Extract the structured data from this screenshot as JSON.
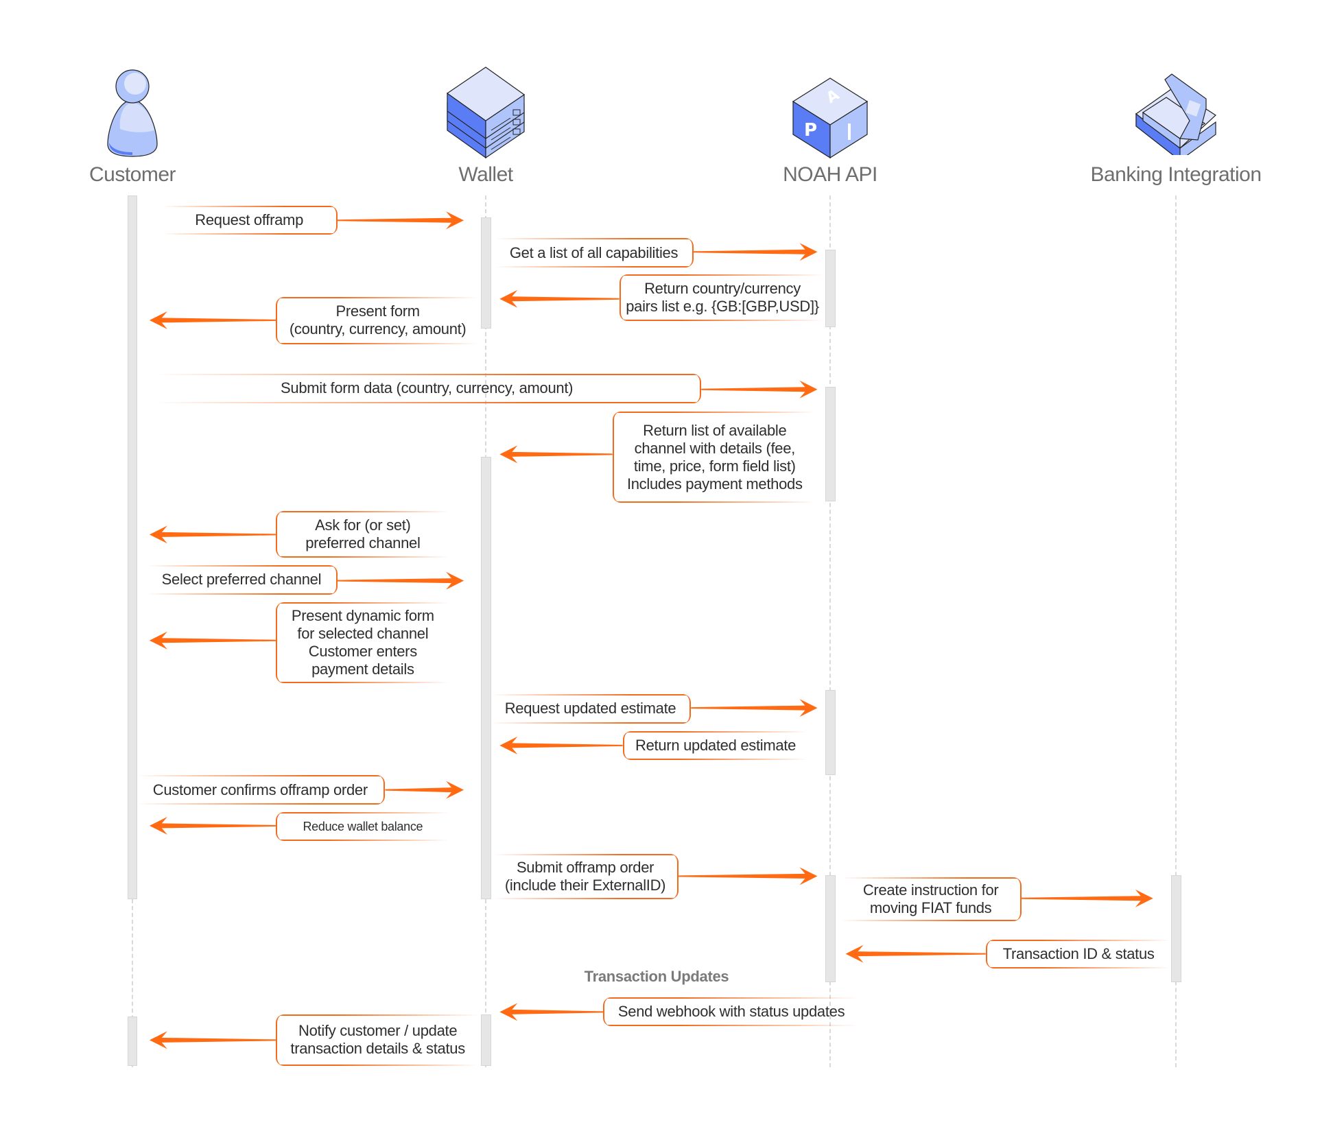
{
  "actors": [
    {
      "label": "Customer",
      "icon": "person-icon"
    },
    {
      "label": "Wallet",
      "icon": "server-stack-icon"
    },
    {
      "label": "NOAH API",
      "icon": "api-cube-icon"
    },
    {
      "label": "Banking Integration",
      "icon": "cash-register-icon"
    }
  ],
  "colors": {
    "arrow": "#ff6a13",
    "box_border": "#f26b1d",
    "icon_dark": "#5a7cf5",
    "icon_mid": "#aec4fa",
    "icon_light": "#dfe6fb",
    "title": "#6e6e6e"
  },
  "messages": [
    {
      "text": "Request offramp",
      "from": "Customer",
      "to": "Wallet"
    },
    {
      "text": "Get a list of all capabilities",
      "from": "Wallet",
      "to": "NOAH API"
    },
    {
      "text": "Return country/currency\npairs list e.g. {GB:[GBP,USD]}",
      "from": "NOAH API",
      "to": "Wallet"
    },
    {
      "text": "Present form\n(country, currency, amount)",
      "from": "Wallet",
      "to": "Customer"
    },
    {
      "text": "Submit form data (country, currency, amount)",
      "from": "Customer",
      "to": "NOAH API"
    },
    {
      "text": "Return list of available\nchannel with details (fee,\ntime, price, form field list)\nIncludes payment methods",
      "from": "NOAH API",
      "to": "Wallet"
    },
    {
      "text": "Ask for (or set)\npreferred channel",
      "from": "Wallet",
      "to": "Customer"
    },
    {
      "text": "Select preferred channel",
      "from": "Customer",
      "to": "Wallet"
    },
    {
      "text": "Present dynamic form\nfor selected channel\nCustomer enters\npayment details",
      "from": "Wallet",
      "to": "Customer"
    },
    {
      "text": "Request updated estimate",
      "from": "Wallet",
      "to": "NOAH API"
    },
    {
      "text": "Return updated estimate",
      "from": "NOAH API",
      "to": "Wallet"
    },
    {
      "text": "Customer confirms offramp order",
      "from": "Customer",
      "to": "Wallet"
    },
    {
      "text": "Reduce wallet balance",
      "from": "Wallet",
      "to": "Customer"
    },
    {
      "text": "Submit offramp order\n(include their ExternalID)",
      "from": "Wallet",
      "to": "NOAH API"
    },
    {
      "text": "Create instruction for\nmoving FIAT funds",
      "from": "NOAH API",
      "to": "Banking Integration"
    },
    {
      "text": "Transaction ID & status",
      "from": "Banking Integration",
      "to": "NOAH API"
    },
    {
      "text": "Send webhook with status updates",
      "from": "NOAH API",
      "to": "Wallet"
    },
    {
      "text": "Notify customer / update\ntransaction details & status",
      "from": "Wallet",
      "to": "Customer"
    }
  ],
  "section_label": "Transaction Updates"
}
